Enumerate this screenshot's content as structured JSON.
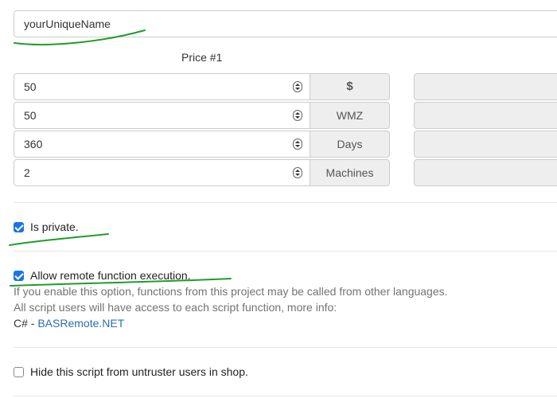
{
  "name_field": {
    "value": "yourUniqueName"
  },
  "price": {
    "title": "Price #1",
    "rows": [
      {
        "value": "50",
        "unit": "$"
      },
      {
        "value": "50",
        "unit": "WMZ"
      },
      {
        "value": "360",
        "unit": "Days"
      },
      {
        "value": "2",
        "unit": "Machines"
      }
    ]
  },
  "options": {
    "is_private": {
      "label": "Is private.",
      "checked": true
    },
    "remote_exec": {
      "label": "Allow remote function execution.",
      "checked": true,
      "help_line1": "If you enable this option, functions from this project may be called from other languages.",
      "help_line2": "All script users will have access to each script function, more info:",
      "lang_prefix": "C# - ",
      "link_text": "BASRemote.NET"
    },
    "hide_script": {
      "label": "Hide this script from untruster users in shop.",
      "checked": false
    }
  },
  "colors": {
    "annotation": "#1f9d2b",
    "checkbox": "#1a73e8",
    "link": "#2a6fb8"
  }
}
